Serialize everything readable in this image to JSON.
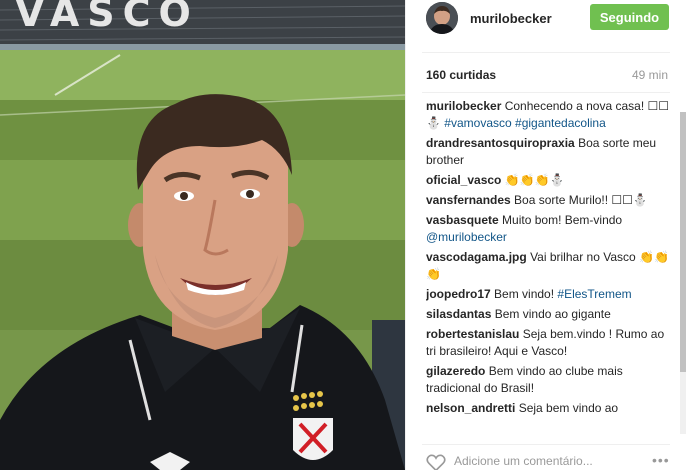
{
  "post": {
    "username": "murilobecker",
    "follow_label": "Seguindo",
    "likes": "160 curtidas",
    "time": "49 min",
    "stadium_sign": "VASCO"
  },
  "comments": [
    {
      "user": "murilobecker",
      "parts": [
        {
          "t": "Conhecendo a nova casa! ☐☐⛄"
        },
        {
          "t": " "
        },
        {
          "t": "#vamovasco",
          "tag": true
        },
        {
          "t": " "
        },
        {
          "t": "#gigantedacolina",
          "tag": true
        }
      ]
    },
    {
      "user": "drandresantosquiropraxia",
      "parts": [
        {
          "t": "Boa sorte meu brother"
        }
      ]
    },
    {
      "user": "oficial_vasco",
      "parts": [
        {
          "t": "👏👏👏⛄"
        }
      ]
    },
    {
      "user": "vansfernandes",
      "parts": [
        {
          "t": "Boa sorte Murilo!! ☐☐⛄"
        }
      ]
    },
    {
      "user": "vasbasquete",
      "parts": [
        {
          "t": "Muito bom! Bem-vindo "
        },
        {
          "t": "@murilobecker",
          "tag": true
        }
      ]
    },
    {
      "user": "vascodagama.jpg",
      "parts": [
        {
          "t": "Vai brilhar no Vasco 👏👏👏"
        }
      ]
    },
    {
      "user": "joopedro17",
      "parts": [
        {
          "t": "Bem vindo! "
        },
        {
          "t": "#ElesTremem",
          "tag": true
        }
      ]
    },
    {
      "user": "silasdantas",
      "parts": [
        {
          "t": "Bem vindo ao gigante"
        }
      ]
    },
    {
      "user": "robertestanislau",
      "parts": [
        {
          "t": "Seja bem.vindo ! Rumo ao tri brasileiro! Aqui e Vasco!"
        }
      ]
    },
    {
      "user": "gilazeredo",
      "parts": [
        {
          "t": "Bem vindo ao clube mais tradicional do Brasil!"
        }
      ]
    },
    {
      "user": "nelson_andretti",
      "parts": [
        {
          "t": "Seja bem vindo ao"
        }
      ]
    }
  ],
  "footer": {
    "comment_placeholder": "Adicione um comentário...",
    "more_label": "•••"
  },
  "icons": {
    "like": "heart-icon",
    "more": "more-options-icon"
  },
  "colors": {
    "follow_button": "#70c050",
    "tag": "#125688"
  }
}
